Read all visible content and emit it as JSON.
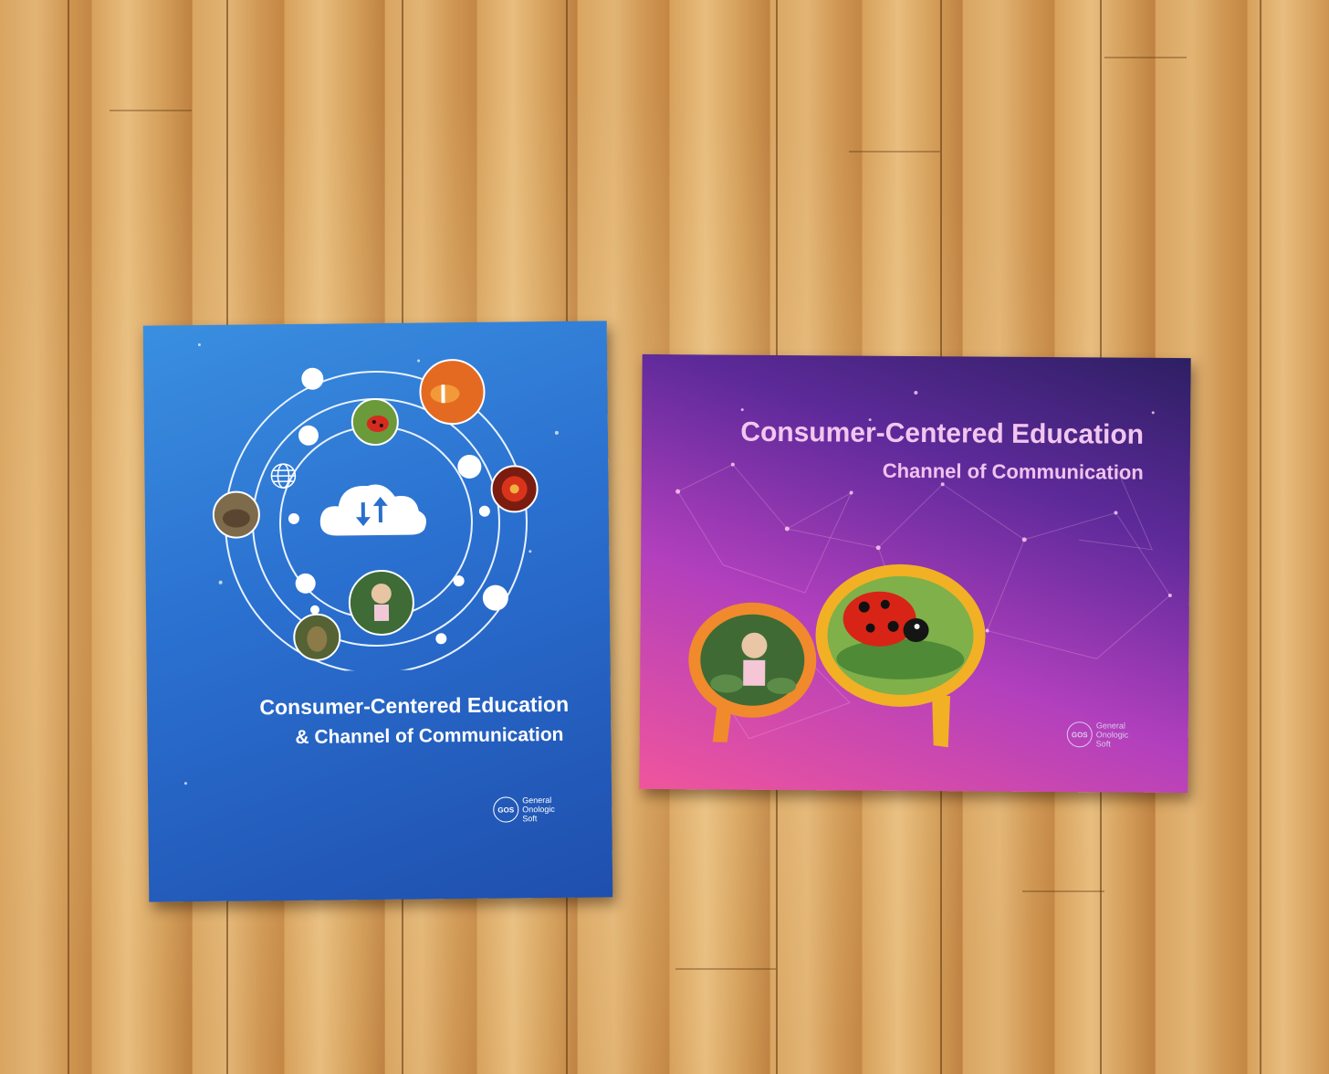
{
  "scene": {
    "description_label": "Two brochures on a wooden floor",
    "floor_color": "#d9a561"
  },
  "blue_book": {
    "title": "Consumer-Centered Education",
    "subtitle": "& Channel of Communication",
    "logo": {
      "mark": "GOS",
      "line1": "General",
      "line2": "Onologic",
      "line3": "Soft"
    },
    "accent_color": "#2a6fcf",
    "icons": [
      "cloud-icon",
      "download-arrow-icon",
      "upload-arrow-icon",
      "globe-icon",
      "ladybug-photo",
      "clownfish-photo",
      "flower-photo",
      "tortoise-photo",
      "girl-photo",
      "leopard-photo"
    ]
  },
  "purple_book": {
    "title": "Consumer-Centered Education",
    "subtitle": "Channel of Communication",
    "logo": {
      "mark": "GOS",
      "line1": "General",
      "line2": "Onologic",
      "line3": "Soft"
    },
    "accent_color": "#b13fbd",
    "bubble_colors": [
      "#f08a2c",
      "#f2b024"
    ],
    "icons": [
      "speech-bubble-girl",
      "speech-bubble-ladybug"
    ]
  }
}
